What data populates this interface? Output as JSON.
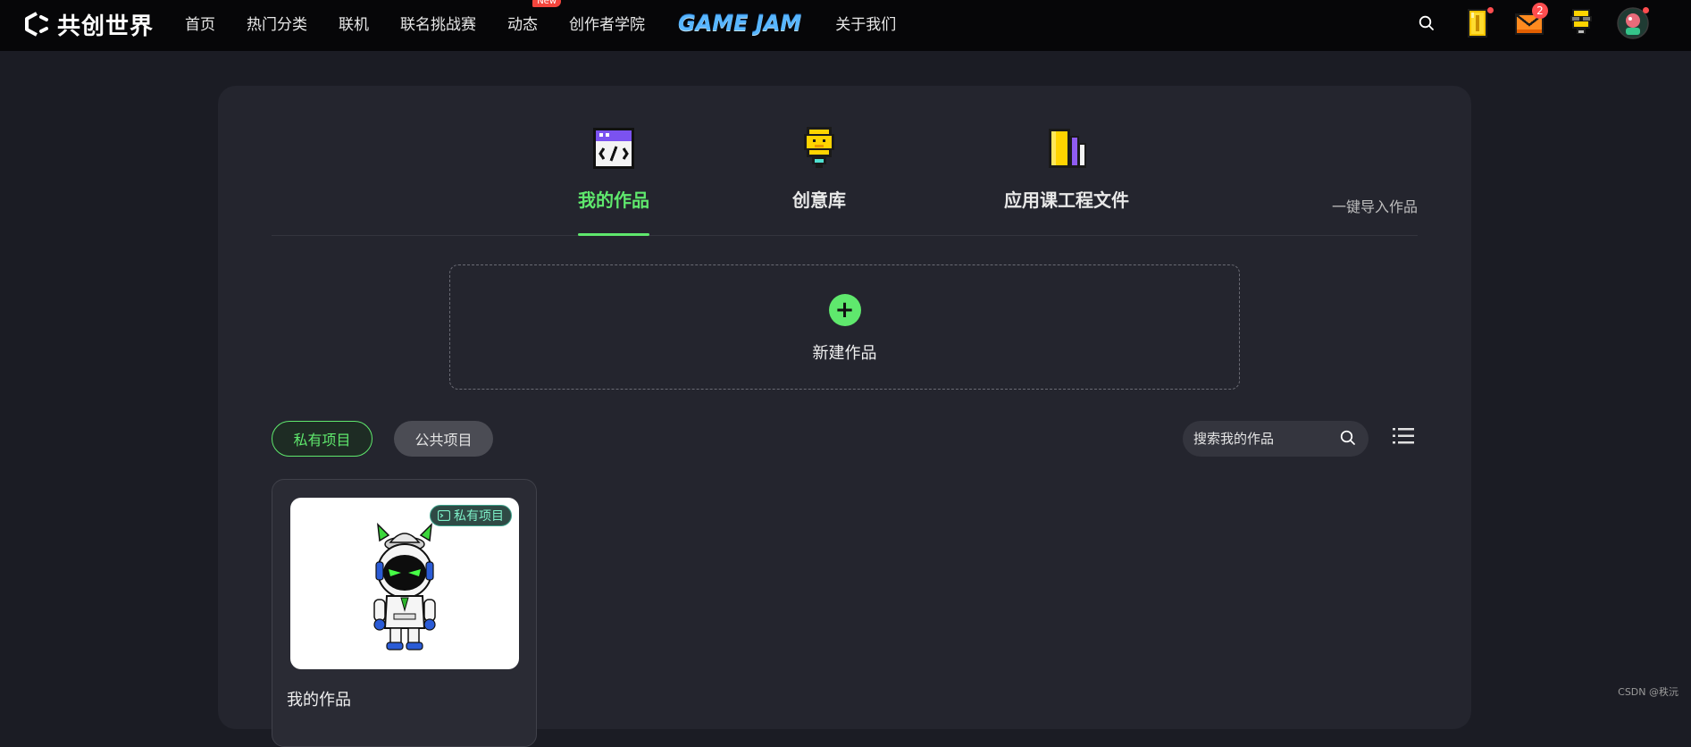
{
  "header": {
    "logo_text": "共创世界",
    "nav": [
      {
        "label": "首页"
      },
      {
        "label": "热门分类"
      },
      {
        "label": "联机"
      },
      {
        "label": "联名挑战赛"
      },
      {
        "label": "动态",
        "badge": "New"
      },
      {
        "label": "创作者学院"
      }
    ],
    "gamejam_label": "GAME JAM",
    "about_label": "关于我们",
    "mail_count": "2"
  },
  "tabs": [
    {
      "label": "我的作品",
      "icon": "code-window-icon",
      "active": true
    },
    {
      "label": "创意库",
      "icon": "lightbulb-icon",
      "active": false
    },
    {
      "label": "应用课工程文件",
      "icon": "folder-icon",
      "active": false
    }
  ],
  "import_label": "一键导入作品",
  "new_work_label": "新建作品",
  "filters": {
    "private_label": "私有项目",
    "public_label": "公共项目",
    "search_placeholder": "搜索我的作品"
  },
  "cards": [
    {
      "title": "我的作品",
      "tag": "私有项目"
    }
  ],
  "watermark": "CSDN @秩沅",
  "colors": {
    "accent_green": "#5fe86d",
    "background": "#1b1c24",
    "panel": "#24252e",
    "topbar": "#060608",
    "badge_red": "#ff4d4f"
  }
}
